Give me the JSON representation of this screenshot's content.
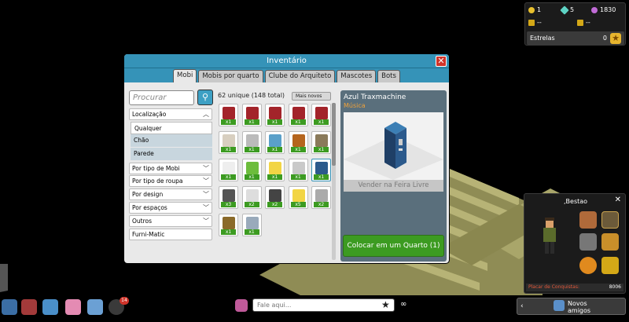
{
  "currency": {
    "credits": "1",
    "diamonds": "5",
    "duckets": "1830",
    "item_a": "--",
    "item_b": "--",
    "estrelas_label": "Estrelas",
    "estrelas_value": "0"
  },
  "inventory": {
    "title": "Inventário",
    "tabs": [
      "Mobi",
      "Mobis por quarto",
      "Clube do Arquiteto",
      "Mascotes",
      "Bots"
    ],
    "search_placeholder": "Procurar",
    "count_label": "62 unique (148 total)",
    "sort_label": "Mais novos",
    "sidebar": {
      "localizacao": "Localização",
      "qualquer": "Qualquer",
      "chao": "Chão",
      "parede": "Parede",
      "filters": [
        "Por tipo de Mobi",
        "Por tipo de roupa",
        "Por design",
        "Por espaços",
        "Outros"
      ],
      "furnimatic": "Furni-Matic"
    },
    "items": [
      {
        "qty": "x1"
      },
      {
        "qty": "x1"
      },
      {
        "qty": "x1"
      },
      {
        "qty": "x1"
      },
      {
        "qty": "x1"
      },
      {
        "qty": "x1"
      },
      {
        "qty": "x1"
      },
      {
        "qty": "x1"
      },
      {
        "qty": "x1"
      },
      {
        "qty": "x1"
      },
      {
        "qty": "x1"
      },
      {
        "qty": "x1"
      },
      {
        "qty": "x1"
      },
      {
        "qty": "x1"
      },
      {
        "qty": "x1"
      },
      {
        "qty": "x3"
      },
      {
        "qty": "x2"
      },
      {
        "qty": "x2"
      },
      {
        "qty": "x5"
      },
      {
        "qty": "x2"
      },
      {
        "qty": "x1"
      },
      {
        "qty": "x1"
      }
    ],
    "preview": {
      "name": "Azul Traxmachine",
      "category": "Música",
      "sell_label": "Vender na Feira Livre",
      "place_label": "Colocar em um Quarto (1)"
    }
  },
  "achievements": {
    "user": ",Bestao",
    "footer_label": "Placar de Conquistas:",
    "footer_value": "8006"
  },
  "toolbar": {
    "badge": "14",
    "chat_placeholder": "Fale aqui...",
    "friends_label": "Novos amigos"
  },
  "colors": {
    "accent": "#3593b8",
    "green": "#3c9b21",
    "close": "#d0342a"
  }
}
